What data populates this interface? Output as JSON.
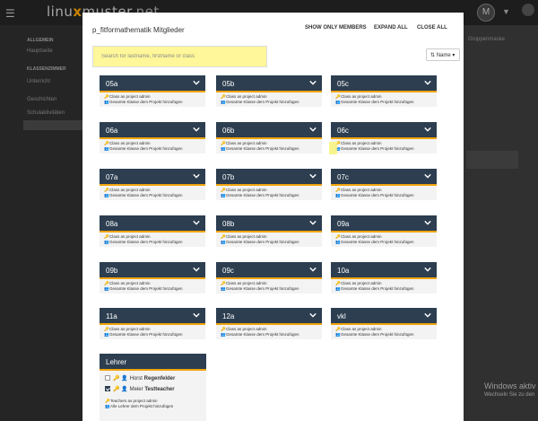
{
  "background": {
    "logo_text": "linu",
    "logo_x": "x",
    "logo_rest": "muster",
    "logo_net": ".net",
    "avatar_initial": "M",
    "sidebar_sections": [
      "ALLGEMEIN",
      "KLASSENZIMMER"
    ],
    "sidebar_items": [
      "Hauptseite",
      "Unterricht",
      "Geschichten",
      "Schulaktivitäten"
    ],
    "group_button": "Gruppenmaske",
    "watermark_title": "Windows aktiv",
    "watermark_sub": "Wechseln Sie zu den"
  },
  "modal": {
    "title": "p_fitformathematik Mitglieder",
    "show_only_members": "SHOW ONLY MEMBERS",
    "expand_all": "EXPAND ALL",
    "close_all": "CLOSE ALL",
    "search_placeholder": "Search for lastname, firstname or class",
    "sort_label": "Name",
    "card_row1": "Class as project admin",
    "card_row2": "Gesamte Klasse dem Projekt hinzufügen",
    "classes": [
      "05a",
      "05b",
      "05c",
      "06a",
      "06b",
      "06c",
      "07a",
      "07b",
      "07c",
      "08a",
      "08b",
      "09a",
      "09b",
      "09c",
      "10a",
      "11a",
      "12a",
      "vkl"
    ],
    "lehrer": {
      "title": "Lehrer",
      "members": [
        {
          "first": "Horst",
          "last": "Regenfelder",
          "checked": false
        },
        {
          "first": "Meier",
          "last": "Testteacher",
          "checked": true
        }
      ],
      "row1": "Teachers as project admin",
      "row2": "Alle Lehrer dem Projekt hinzufügen"
    }
  },
  "colors": {
    "card_header": "#2c3e50",
    "accent": "#f0a30a",
    "highlight": "#fff799"
  }
}
